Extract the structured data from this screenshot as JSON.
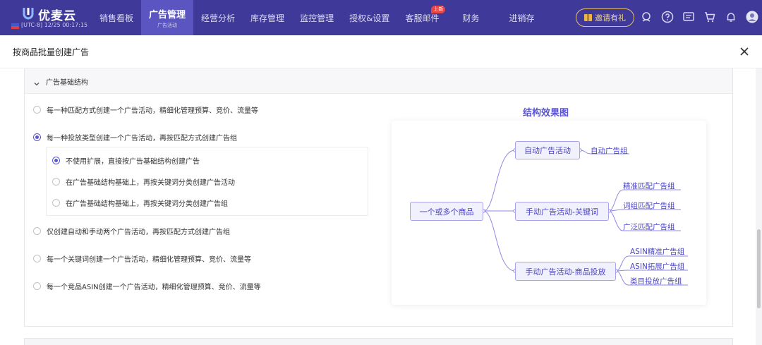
{
  "brand": {
    "name": "优麦云",
    "time": "[UTC-8] 12/25 00:17:15"
  },
  "nav": {
    "items": [
      {
        "label": "销售看板"
      },
      {
        "label": "广告管理",
        "sub": "广告活动"
      },
      {
        "label": "经营分析"
      },
      {
        "label": "库存管理"
      },
      {
        "label": "监控管理"
      },
      {
        "label": "授权&设置"
      },
      {
        "label": "客服邮件",
        "badge": "上新"
      },
      {
        "label": "财务"
      },
      {
        "label": "进销存"
      }
    ],
    "invite_label": "邀请有礼"
  },
  "dialog": {
    "title": "按商品批量创建广告"
  },
  "section": {
    "title": "广告基础结构",
    "options": [
      {
        "label": "每一种匹配方式创建一个广告活动，精细化管理预算、竞价、流量等",
        "checked": false
      },
      {
        "label": "每一种投放类型创建一个广告活动，再按匹配方式创建广告组",
        "checked": true
      },
      {
        "label": "仅创建自动和手动两个广告活动，再按匹配方式创建广告组",
        "checked": false
      },
      {
        "label": "每一个关键词创建一个广告活动，精细化管理预算、竞价、流量等",
        "checked": false
      },
      {
        "label": "每一个竞品ASIN创建一个广告活动，精细化管理预算、竞价、流量等",
        "checked": false
      }
    ],
    "sub_options": [
      {
        "label": "不使用扩展，直接按广告基础结构创建广告",
        "checked": true
      },
      {
        "label": "在广告基础结构基础上，再按关键词分类创建广告活动",
        "checked": false
      },
      {
        "label": "在广告基础结构基础上，再按关键词分类创建广告组",
        "checked": false
      }
    ]
  },
  "diagram": {
    "title": "结构效果图",
    "root": "一个或多个商品",
    "branches": [
      {
        "label": "自动广告活动",
        "children": [
          "自动广告组"
        ]
      },
      {
        "label": "手动广告活动-关键词",
        "children": [
          "精准匹配广告组",
          "词组匹配广告组",
          "广泛匹配广告组"
        ]
      },
      {
        "label": "手动广告活动-商品投放",
        "children": [
          "ASIN精准广告组",
          "ASIN拓展广告组",
          "类目投放广告组"
        ]
      }
    ]
  },
  "colors": {
    "nav_bg": "#3f3a99",
    "accent": "#5b55d6",
    "node_bg": "#f1f0fd"
  }
}
